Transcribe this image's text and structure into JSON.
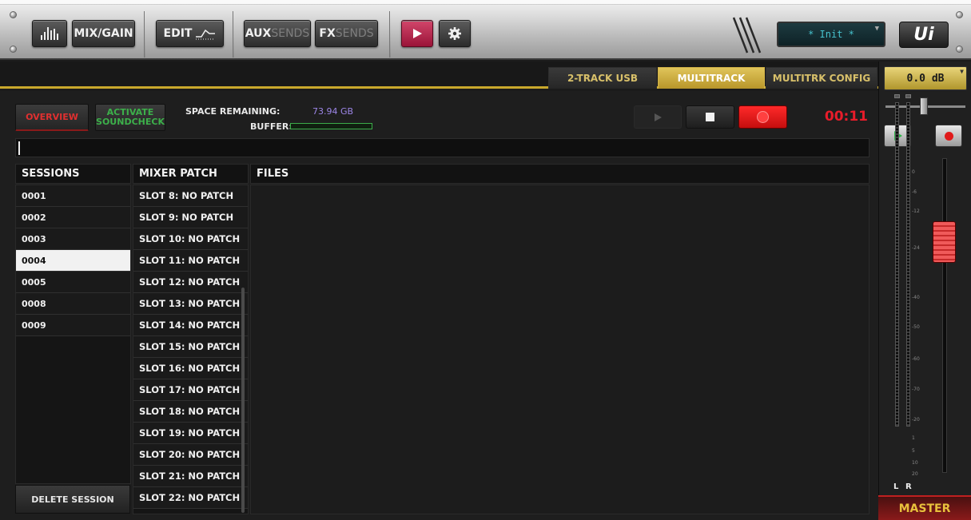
{
  "toolbar": {
    "mix_gain_label": "MIX/GAIN",
    "edit_label": "EDIT",
    "aux_label_bold": "AUX",
    "aux_label_dim": "SENDS",
    "fx_label_bold": "FX",
    "fx_label_dim": "SENDS",
    "snapshot_display": "* Init *",
    "logo_text": "Ui",
    "icons": [
      "meters-icon",
      "edit-curve-icon",
      "play-icon",
      "gear-icon",
      "chevron-down-icon"
    ]
  },
  "tabs": {
    "two_track": "2-TRACK USB",
    "multitrack": "MULTITRACK",
    "config": "MULTITRK CONFIG",
    "active": "MULTITRACK"
  },
  "controls": {
    "overview_label": "OVERVIEW",
    "soundcheck_line1": "ACTIVATE",
    "soundcheck_line2": "SOUNDCHECK",
    "space_label": "SPACE REMAINING:",
    "space_value": "73.94 GB",
    "buffer_label": "BUFFER:",
    "timer": "00:11"
  },
  "sessions": {
    "header": "SESSIONS",
    "items": [
      "0001",
      "0002",
      "0003",
      "0004",
      "0005",
      "0008",
      "0009"
    ],
    "selected": "0004",
    "delete_label": "DELETE SESSION"
  },
  "mixer_patch": {
    "header": "MIXER PATCH",
    "items": [
      "SLOT 8: NO PATCH",
      "SLOT 9: NO PATCH",
      "SLOT 10: NO PATCH",
      "SLOT 11: NO PATCH",
      "SLOT 12: NO PATCH",
      "SLOT 13: NO PATCH",
      "SLOT 14: NO PATCH",
      "SLOT 15: NO PATCH",
      "SLOT 16: NO PATCH",
      "SLOT 17: NO PATCH",
      "SLOT 18: NO PATCH",
      "SLOT 19: NO PATCH",
      "SLOT 20: NO PATCH",
      "SLOT 21: NO PATCH",
      "SLOT 22: NO PATCH"
    ]
  },
  "files": {
    "header": "FILES"
  },
  "master": {
    "level_display": "0.0 dB",
    "scale": [
      "0",
      "-6",
      "-12",
      "-24",
      "-40",
      "-50",
      "-60",
      "-70",
      "-20",
      "1",
      "5",
      "10",
      "20"
    ],
    "left_label": "L",
    "right_label": "R",
    "label": "MASTER"
  },
  "colors": {
    "accent_gold": "#c9a82c",
    "record_red": "#e81c2a",
    "play_pink": "#c0244e",
    "overview_red": "#e03030",
    "soundcheck_green": "#3cb04a",
    "space_value_purple": "#9d86e8"
  }
}
